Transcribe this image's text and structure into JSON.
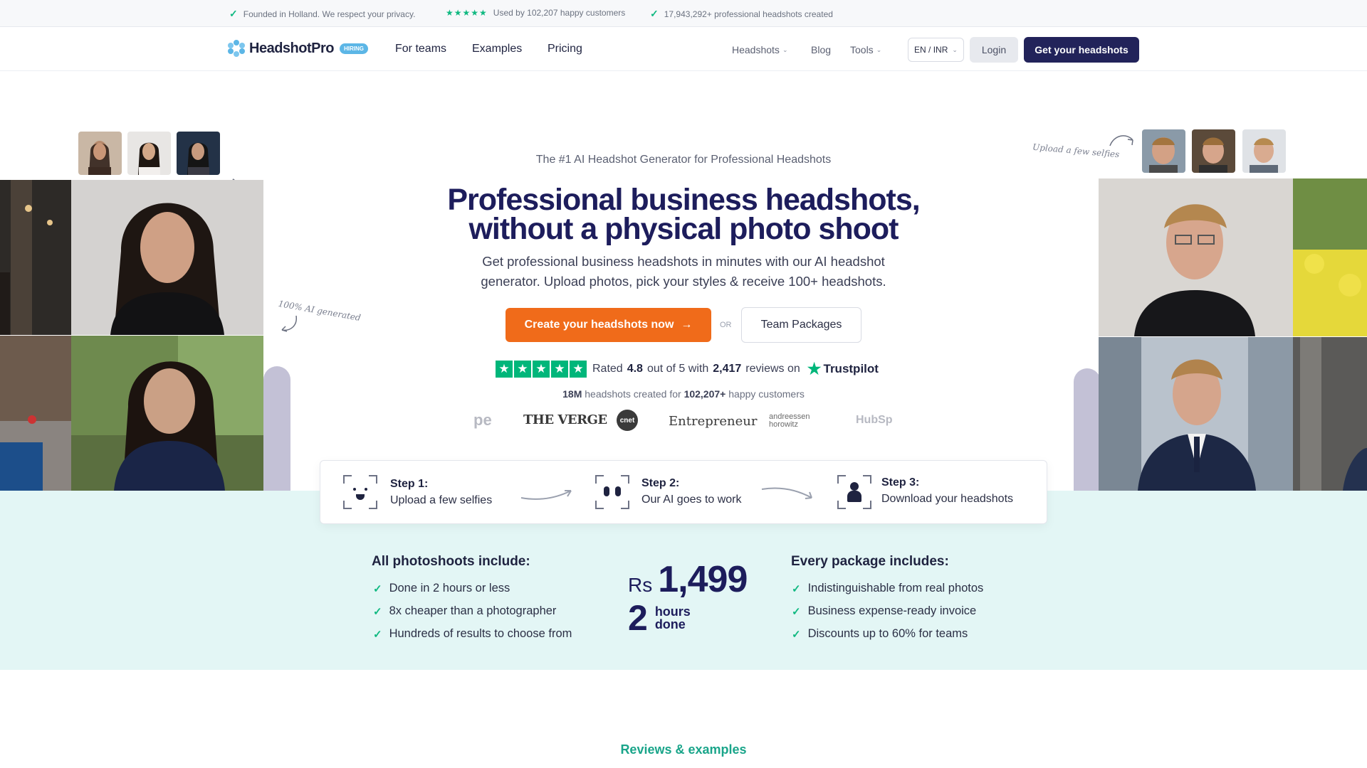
{
  "topbar": {
    "founded": "Founded in Holland. We respect your privacy.",
    "stars": "★★★★★",
    "customers": "Used by 102,207 happy customers",
    "created": "17,943,292+ professional headshots created"
  },
  "nav": {
    "brand": "HeadshotPro",
    "hiring": "HIRING",
    "for_teams": "For teams",
    "examples": "Examples",
    "pricing": "Pricing",
    "headshots": "Headshots",
    "blog": "Blog",
    "tools": "Tools",
    "lang": "EN / INR",
    "login": "Login",
    "cta": "Get your headshots"
  },
  "hero": {
    "eyebrow": "The #1 AI Headshot Generator for Professional Headshots",
    "title_line1": "Professional business headshots,",
    "title_line2": "without a physical photo shoot",
    "subtitle": "Get professional business headshots in minutes with our AI headshot generator. Upload photos, pick your styles & receive 100+ headshots.",
    "cta_main": "Create your headshots now",
    "or": "OR",
    "cta_team": "Team Packages",
    "note_left": "100% AI generated",
    "note_right": "Upload a few selfies"
  },
  "rating": {
    "rated": "Rated",
    "score": "4.8",
    "out_of": "out of 5 with",
    "reviews": "2,417",
    "reviews_on": "reviews on",
    "trustpilot": "Trustpilot",
    "stars_value": 5
  },
  "created_line": {
    "count": "18M",
    "mid": "headshots created for",
    "customers": "102,207+",
    "tail": "happy customers"
  },
  "press": [
    "pe",
    "THE VERGE",
    "cnet",
    "Entrepreneur",
    "andreessen horowitz",
    "HubSp"
  ],
  "steps": [
    {
      "title": "Step 1:",
      "desc": "Upload a few selfies"
    },
    {
      "title": "Step 2:",
      "desc": "Our AI goes to work"
    },
    {
      "title": "Step 3:",
      "desc": "Download your headshots"
    }
  ],
  "includes_left": {
    "title": "All photoshoots include:",
    "items": [
      "Done in 2 hours or less",
      "8x cheaper than a photographer",
      "Hundreds of results to choose from"
    ]
  },
  "price": {
    "currency": "Rs",
    "amount": "1,499",
    "hours": "2",
    "hours_label1": "hours",
    "hours_label2": "done"
  },
  "includes_right": {
    "title": "Every package includes:",
    "items": [
      "Indistinguishable from real photos",
      "Business expense-ready invoice",
      "Discounts up to 60% for teams"
    ]
  },
  "reviews_heading": "Reviews & examples",
  "colors": {
    "navy": "#22235a",
    "orange": "#f06b1a",
    "green": "#10b981",
    "trustpilot": "#00b67a",
    "teal_bg": "#e3f6f5"
  }
}
